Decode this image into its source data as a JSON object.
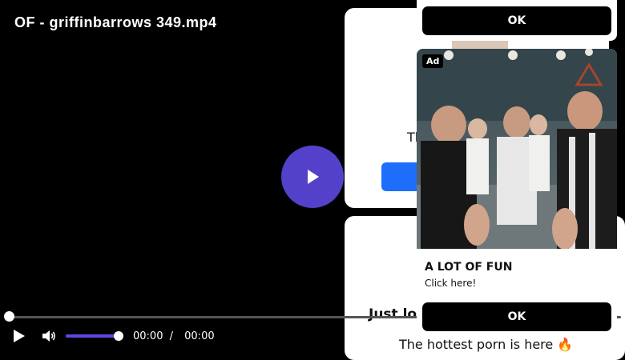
{
  "video": {
    "title": "OF - griffinbarrows 349.mp4",
    "current_time": "00:00",
    "separator": "/",
    "duration": "00:00",
    "progress": 0,
    "volume": 1.0,
    "accent_color": "#5342c9"
  },
  "side_cards": {
    "top_text_fragment": "Th",
    "bottom_headline": "Just loo",
    "bottom_tagline": "The hottest porn is here 🔥"
  },
  "ad": {
    "badge": "Ad",
    "headline": "A LOT OF FUN",
    "subtext": "Click here!",
    "ok_label_top": "OK",
    "ok_label_bottom": "OK"
  },
  "icons": {
    "big_play": "play-icon",
    "control_play": "play-icon",
    "volume": "volume-icon"
  }
}
